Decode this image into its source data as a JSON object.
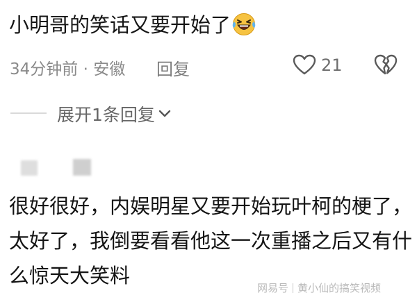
{
  "comments": [
    {
      "text": "小明哥的笑话又要开始了",
      "emoji": "laughing-crying-emoji",
      "time": "34分钟前",
      "separator": "·",
      "location": "安徽",
      "reply_label": "回复",
      "like_count": "21"
    },
    {
      "text": "很好很好，内娱明星又要开始玩叶柯的梗了，太好了，我倒要看看他这一次重播之后又有什么惊天大笑料"
    }
  ],
  "expand_replies_label": "展开1条回复",
  "watermark": {
    "brand": "网易号",
    "account": "黄小仙的搞笑视频"
  },
  "colors": {
    "text": "#161616",
    "meta": "#8a8a8a",
    "emoji": "#f6c342"
  }
}
